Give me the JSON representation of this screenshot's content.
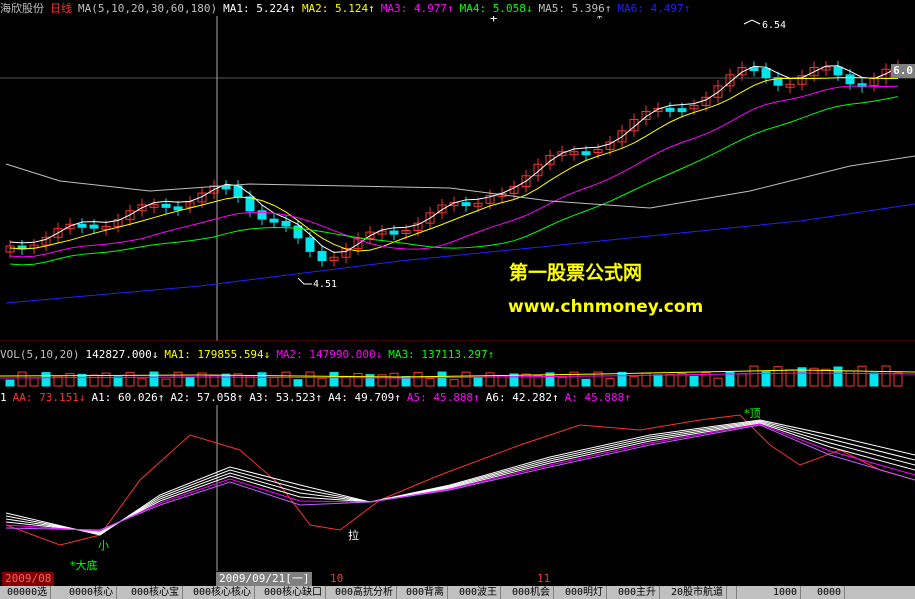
{
  "header": {
    "stock": "海欣股份",
    "period": "日线",
    "ma_label": "MA(5,10,20,30,60,180)",
    "items": [
      {
        "text": "MA1: 5.224↑",
        "color": "#ffffff"
      },
      {
        "text": "MA2: 5.124↑",
        "color": "#ffff00"
      },
      {
        "text": "MA3: 4.977↑",
        "color": "#ff00ff"
      },
      {
        "text": "MA4: 5.058↓",
        "color": "#00ff00"
      },
      {
        "text": "MA5: 5.396↑",
        "color": "#c0c0c0"
      },
      {
        "text": "MA6: 4.497↑",
        "color": "#2020ff"
      }
    ]
  },
  "price_box": "6.0",
  "annotations": {
    "high": "6.54",
    "low": "4.51"
  },
  "watermark": {
    "title": "第一股票公式网",
    "url": "www.chnmoney.com"
  },
  "vol_header": {
    "label": "VOL(5,10,20)",
    "items": [
      {
        "text": "142827.000↓",
        "color": "#ffffff"
      },
      {
        "text": "MA1: 179855.594↓",
        "color": "#ffff00"
      },
      {
        "text": "MA2: 147990.000↓",
        "color": "#ff00ff"
      },
      {
        "text": "MA3: 137113.297↑",
        "color": "#00ff00"
      }
    ]
  },
  "ind_header": {
    "prefix": "1",
    "items": [
      {
        "text": "AA: 73.151↓",
        "color": "#ff3030"
      },
      {
        "text": "A1: 60.026↑",
        "color": "#ffffff"
      },
      {
        "text": "A2: 57.058↑",
        "color": "#ffffff"
      },
      {
        "text": "A3: 53.523↑",
        "color": "#ffffff"
      },
      {
        "text": "A4: 49.709↑",
        "color": "#ffffff"
      },
      {
        "text": "A5: 45.888↑",
        "color": "#ff00ff"
      },
      {
        "text": "A6: 42.282↑",
        "color": "#ffffff"
      },
      {
        "text": "A: 45.888↑",
        "color": "#ff00ff"
      }
    ]
  },
  "ind_labels": {
    "top": "*顶",
    "small": "小",
    "pull": "拉",
    "bottom": "*大底"
  },
  "dates": [
    "2009/08",
    "2009/09/21[一]",
    "10",
    "11"
  ],
  "tabs": [
    "00000选",
    "0000核心",
    "000核心宝",
    "000核心核心",
    "000核心缺口",
    "000高抗分析",
    "000背离",
    "000波王",
    "000机会",
    "000明灯",
    "000主升",
    "20股市航道",
    "  ",
    "1000",
    "0000"
  ],
  "colors": {
    "up": "#ff3030",
    "down": "#00e5ee",
    "ma1": "#ffffff",
    "ma2": "#ffff00",
    "ma3": "#ff00ff",
    "ma4": "#00ff00",
    "ma5": "#c0c0c0",
    "ma6": "#2020ff"
  }
}
